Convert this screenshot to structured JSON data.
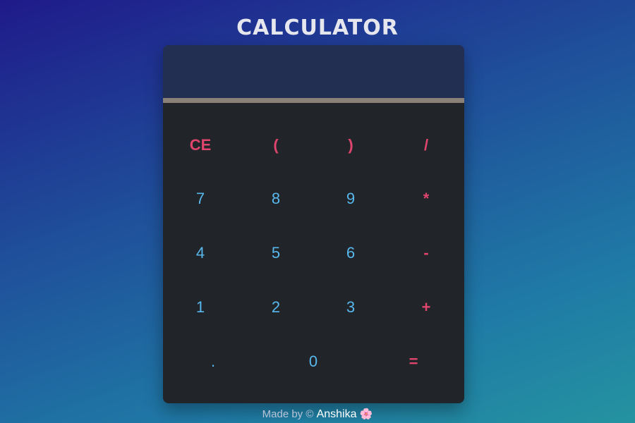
{
  "app": {
    "title": "CALCULATOR"
  },
  "display": {
    "value": ""
  },
  "keys": {
    "row1": [
      "CE",
      "(",
      ")",
      "/"
    ],
    "row2": [
      "7",
      "8",
      "9",
      "*"
    ],
    "row3": [
      "4",
      "5",
      "6",
      "-"
    ],
    "row4": [
      "1",
      "2",
      "3",
      "+"
    ],
    "row5": [
      ".",
      "0",
      "="
    ]
  },
  "footer": {
    "prefix": "Made by © ",
    "author": "Anshika",
    "emoji": "🌸"
  },
  "colors": {
    "number": "#58b8ee",
    "operator": "#e0456e",
    "display_bg": "#232f52",
    "body_bg": "#212428"
  }
}
